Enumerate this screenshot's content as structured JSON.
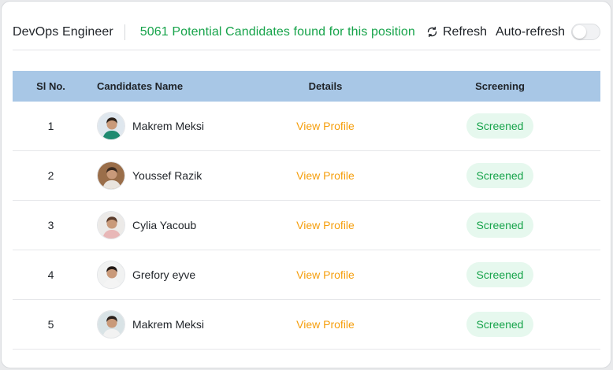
{
  "header": {
    "position_title": "DevOps Engineer",
    "found_text": "5061 Potential Candidates found for this position",
    "refresh_label": "Refresh",
    "auto_refresh_label": "Auto-refresh",
    "auto_refresh_on": false
  },
  "table": {
    "columns": [
      "Sl No.",
      "Candidates Name",
      "Details",
      "Screening"
    ],
    "rows": [
      {
        "sl": "1",
        "name": "Makrem Meksi",
        "details": "View Profile",
        "status": "Screened",
        "avatar_bg": "#dfe7ee",
        "shirt": "#1f8a70",
        "hair": "#2b2119"
      },
      {
        "sl": "2",
        "name": "Youssef Razik",
        "details": "View Profile",
        "status": "Screened",
        "avatar_bg": "#9a6e4a",
        "shirt": "#e9e4de",
        "hair": "#3a2a20"
      },
      {
        "sl": "3",
        "name": "Cylia Yacoub",
        "details": "View Profile",
        "status": "Screened",
        "avatar_bg": "#eceae8",
        "shirt": "#e8b7b7",
        "hair": "#5a3b2a"
      },
      {
        "sl": "4",
        "name": "Grefory eyve",
        "details": "View Profile",
        "status": "Screened",
        "avatar_bg": "#f1f2f2",
        "shirt": "#f4f4f4",
        "hair": "#231a16"
      },
      {
        "sl": "5",
        "name": "Makrem Meksi",
        "details": "View Profile",
        "status": "Screened",
        "avatar_bg": "#d9e3e6",
        "shirt": "#f2f2f2",
        "hair": "#2a211c"
      }
    ]
  },
  "colors": {
    "accent_green": "#16a34a",
    "link_orange": "#f59e0b",
    "table_header": "#a8c7e6",
    "badge_bg": "#e6f8ee"
  }
}
